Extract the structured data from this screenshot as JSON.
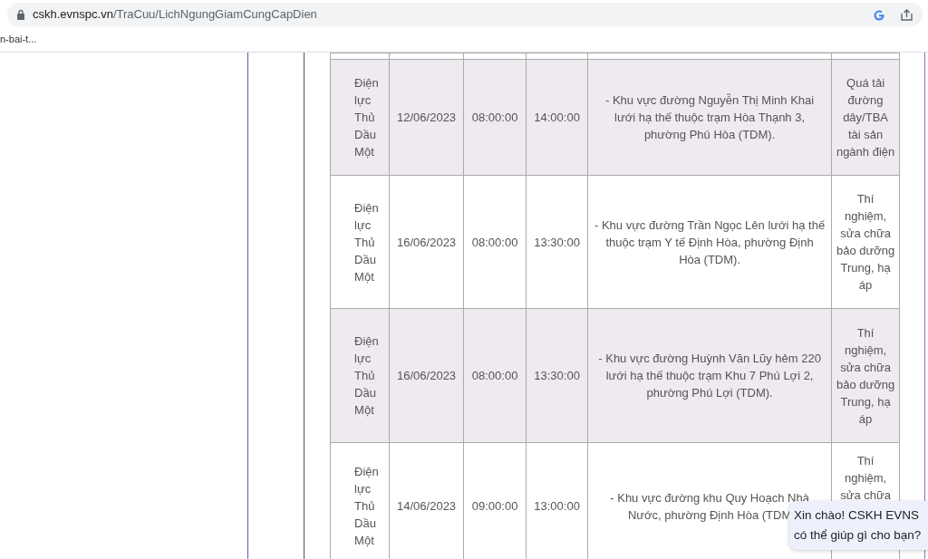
{
  "browser": {
    "address_host": "cskh.evnspc.vn",
    "address_path": "/TraCuu/LichNgungGiamCungCapDien",
    "bookmark": "n-bai-t..."
  },
  "table": {
    "rows": [
      {
        "unit": "Điện lực Thủ Dầu Một",
        "date": "12/06/2023",
        "start": "08:00:00",
        "end": "14:00:00",
        "area": "- Khu vực đường Nguyễn Thị Minh Khai lưới hạ thế thuộc trạm Hòa Thạnh 3, phường Phú Hòa (TDM).",
        "reason": "Quá tải đường dây/TBA tài sản ngành điện",
        "shaded": true
      },
      {
        "unit": "Điện lực Thủ Dầu Một",
        "date": "16/06/2023",
        "start": "08:00:00",
        "end": "13:30:00",
        "area": "- Khu vực đường Trần Ngọc Lên lưới hạ thế thuộc trạm Y tế Định Hòa, phường Định Hòa (TDM).",
        "reason": "Thí nghiệm, sửa chữa bảo dưỡng Trung, hạ áp",
        "shaded": false
      },
      {
        "unit": "Điện lực Thủ Dầu Một",
        "date": "16/06/2023",
        "start": "08:00:00",
        "end": "13:30:00",
        "area": "- Khu vực đường Huỳnh Văn Lũy hẻm 220 lưới hạ thế thuộc trạm Khu 7 Phú Lợi 2, phường Phú Lợi (TDM).",
        "reason": "Thí nghiệm, sửa chữa bảo dưỡng Trung, hạ áp",
        "shaded": true
      },
      {
        "unit": "Điện lực Thủ Dầu Một",
        "date": "14/06/2023",
        "start": "09:00:00",
        "end": "13:00:00",
        "area": "- Khu vực đường khu Quy Hoạch Nhà Nước, phường Định Hòa (TDM",
        "reason": "Thí nghiệm, sửa chữa",
        "shaded": false
      }
    ]
  },
  "chat": {
    "lines": [
      "Xin chào! CSKH EVNS",
      "có thể giúp gì cho bạn?"
    ]
  }
}
